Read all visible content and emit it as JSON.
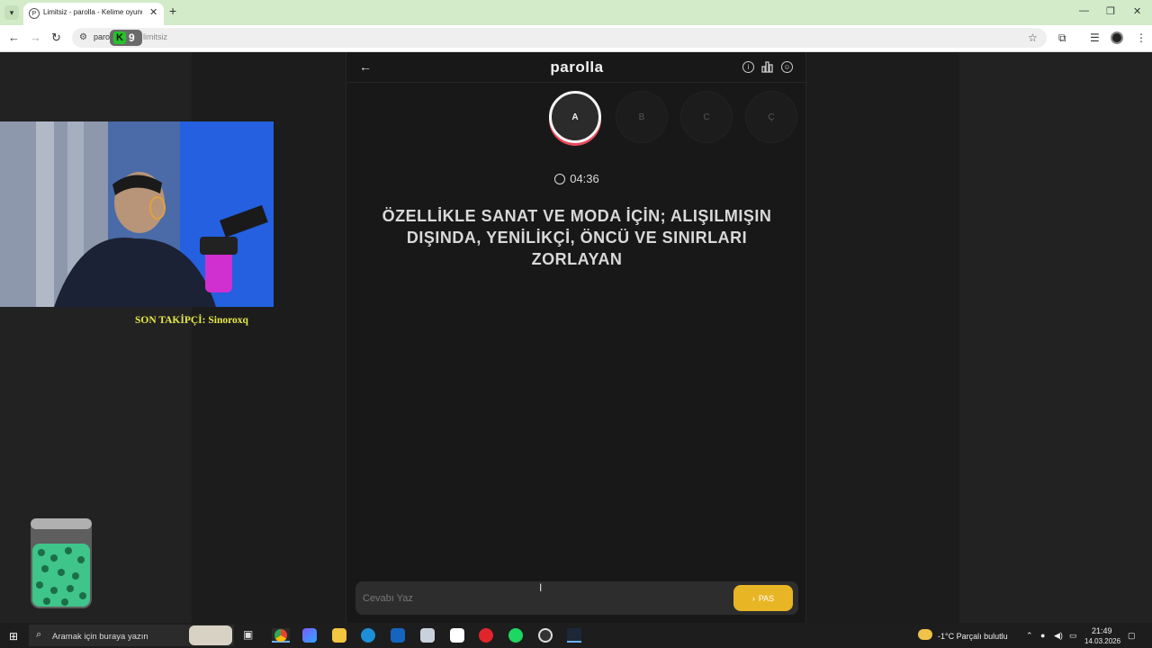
{
  "browser": {
    "tab_title": "Limitsiz - parolla - Kelime oyunu",
    "url_host": "parolla",
    "url_path": "limitsiz"
  },
  "app": {
    "title": "parolla",
    "letters": [
      "A",
      "B",
      "C",
      "Ç"
    ],
    "timer": "04:36",
    "question": "ÖZELLİKLE SANAT VE MODA İÇİN; ALIŞILMIŞIN DIŞINDA, YENİLİKÇİ, ÖNCÜ VE SINIRLARI ZORLAYAN",
    "answer_placeholder": "Cevabı Yaz",
    "pass_label": "PAS"
  },
  "overlay": {
    "logo_k": "K",
    "logo_9": "9",
    "follower": "SON TAKİPÇİ: Sinoroxq"
  },
  "taskbar": {
    "search_placeholder": "Aramak için buraya yazın",
    "weather": "-1°C  Parçalı bulutlu",
    "time": "21:49",
    "date": "14.03.2026"
  },
  "colors": {
    "accent_pass": "#e8b524",
    "active_ring": "#e84a5a",
    "follower_text": "#e8e94a"
  }
}
